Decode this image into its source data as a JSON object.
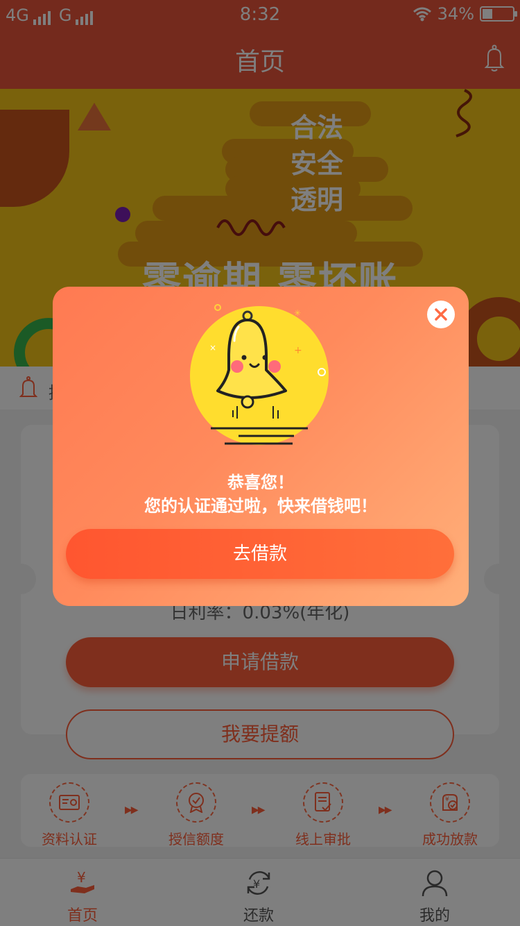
{
  "status_bar": {
    "network1": "4G",
    "network2": "G",
    "time": "8:32",
    "battery_percent": "34%",
    "battery_level": 0.34
  },
  "header": {
    "title": "首页"
  },
  "banner": {
    "slogan_lines": [
      "合法",
      "安全",
      "透明"
    ],
    "headline": "零逾期  零坏账"
  },
  "notice": {
    "text": "招"
  },
  "card": {
    "rate_text": "日利率：0.03%(年化)"
  },
  "buttons": {
    "apply": "申请借款",
    "raise_limit": "我要提额"
  },
  "steps": [
    {
      "label": "资料认证",
      "icon": "id-card-icon"
    },
    {
      "label": "授信额度",
      "icon": "badge-check-icon"
    },
    {
      "label": "线上审批",
      "icon": "document-check-icon"
    },
    {
      "label": "成功放款",
      "icon": "money-bag-check-icon"
    }
  ],
  "step_arrow": "▶▶",
  "tabbar": [
    {
      "label": "首页",
      "icon": "yuan-hand-icon",
      "active": true
    },
    {
      "label": "还款",
      "icon": "yuan-refresh-icon",
      "active": false
    },
    {
      "label": "我的",
      "icon": "user-icon",
      "active": false
    }
  ],
  "modal": {
    "title": "恭喜您！",
    "message": "您的认证通过啦，快来借钱吧！",
    "action": "去借款",
    "illustration": "smiling-bell-icon"
  },
  "colors": {
    "brand": "#e8553a",
    "accent": "#ff5f3a",
    "banner": "#f5c418"
  }
}
